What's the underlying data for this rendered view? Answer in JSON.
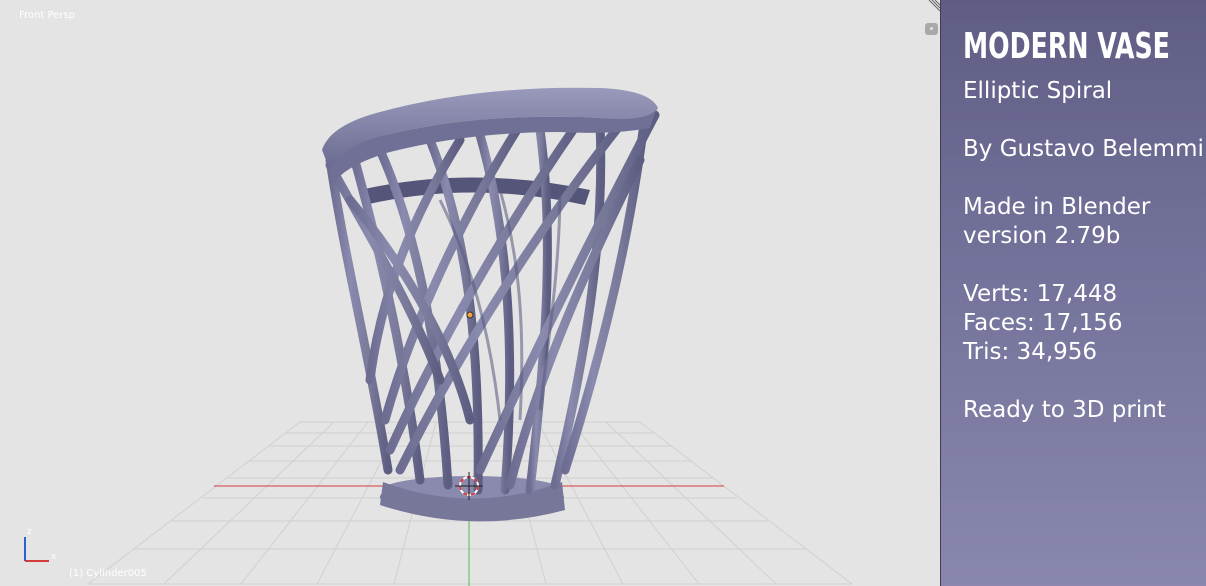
{
  "viewport": {
    "view_label": "Front Persp",
    "object_label": "(1) Cylinder005",
    "axis_labels": {
      "z": "z",
      "x": "x"
    },
    "colors": {
      "background": "#e4e4e4",
      "grid": "#cfcfcf",
      "x_axis": "#d43b3b",
      "y_axis": "#4fbf4f",
      "model_fill": "#777799",
      "model_dark": "#55557a",
      "model_light": "#a6a6c6"
    },
    "icons": [
      "cursor-icon",
      "origin-dot-icon",
      "axis-gizmo-icon",
      "corner-split-icon"
    ]
  },
  "info_panel": {
    "title": "MODERN VASE",
    "subtitle": "Elliptic Spiral",
    "author": "By Gustavo Belemmi",
    "made_in": "Made in Blender",
    "version": "version 2.79b",
    "verts": "Verts: 17,448",
    "faces": "Faces: 17,156",
    "tris": "Tris: 34,956",
    "status": "Ready to 3D print",
    "colors": {
      "top": "#5f5d84",
      "bottom": "#8987ad",
      "text": "#ffffff"
    }
  }
}
